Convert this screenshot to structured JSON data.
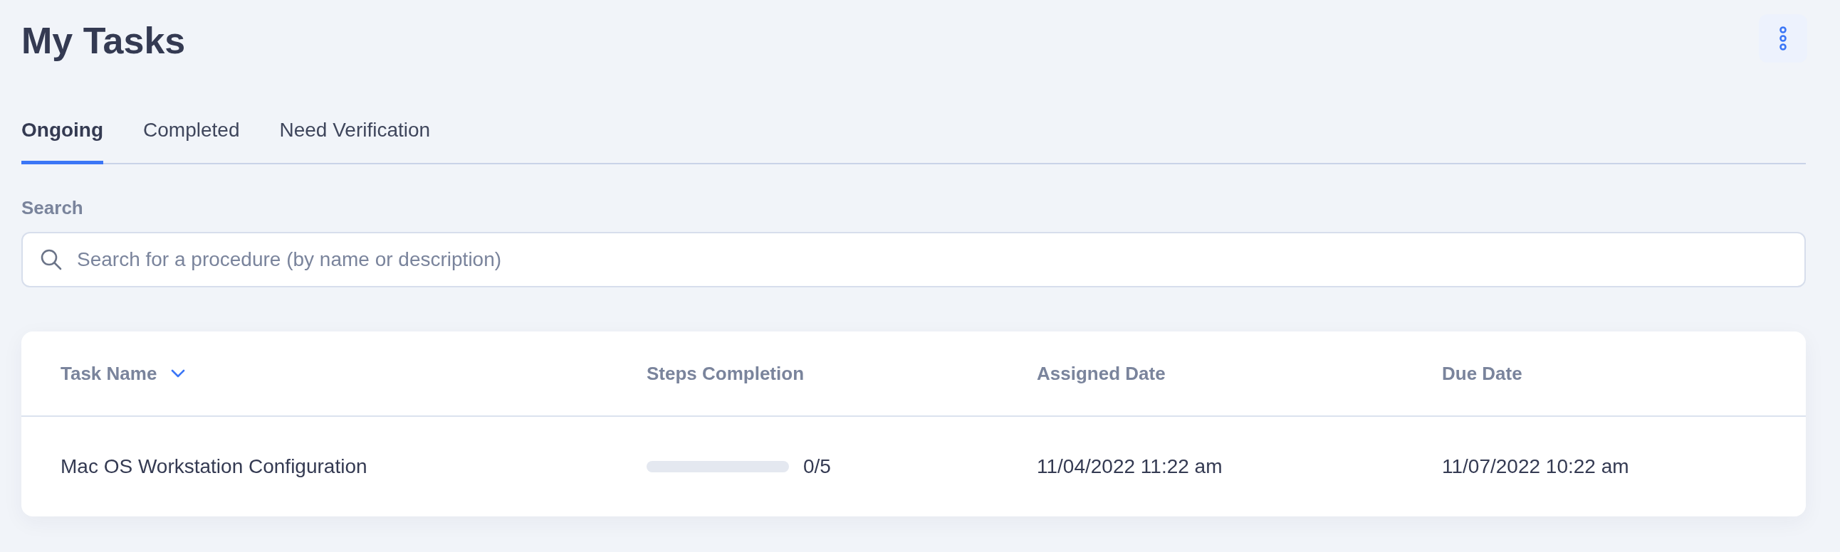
{
  "page": {
    "title": "My Tasks"
  },
  "tabs": [
    {
      "label": "Ongoing",
      "selected": true
    },
    {
      "label": "Completed",
      "selected": false
    },
    {
      "label": "Need Verification",
      "selected": false
    }
  ],
  "search": {
    "label": "Search",
    "placeholder": "Search for a procedure (by name or description)"
  },
  "table": {
    "columns": [
      {
        "label": "Task Name",
        "sorted": true
      },
      {
        "label": "Steps Completion",
        "sorted": false
      },
      {
        "label": "Assigned Date",
        "sorted": false
      },
      {
        "label": "Due Date",
        "sorted": false
      }
    ],
    "rows": [
      {
        "task_name": "Mac OS Workstation Configuration",
        "level": 0,
        "steps": "0/5",
        "assigned_date": "11/04/2022 11:22 am",
        "due_date": "11/07/2022 10:22 am"
      }
    ]
  }
}
